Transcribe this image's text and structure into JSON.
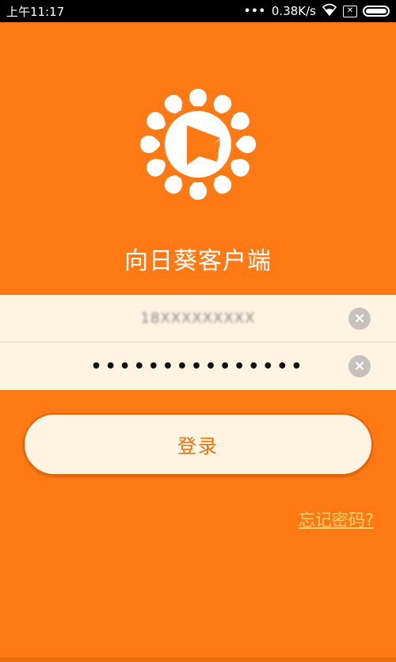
{
  "status_bar": {
    "time": "上午11:17",
    "dots": "•••",
    "network_speed": "0.38K/s",
    "icons": [
      "wifi-icon",
      "sim-icon",
      "battery-icon"
    ],
    "battery_level": 1.0
  },
  "app": {
    "title": "向日葵客户端",
    "logo": "sunflower-play-logo"
  },
  "form": {
    "username_value": "18XXXXXXXXX",
    "password_value": "•••••••••••••••",
    "clear_icon": "clear-icon"
  },
  "actions": {
    "login_label": "登录",
    "forgot_label": "忘记密码?"
  },
  "colors": {
    "background": "#FF7A14",
    "field_bg": "#FFF3E2",
    "button_text": "#E87310",
    "link": "#FFD36B"
  }
}
